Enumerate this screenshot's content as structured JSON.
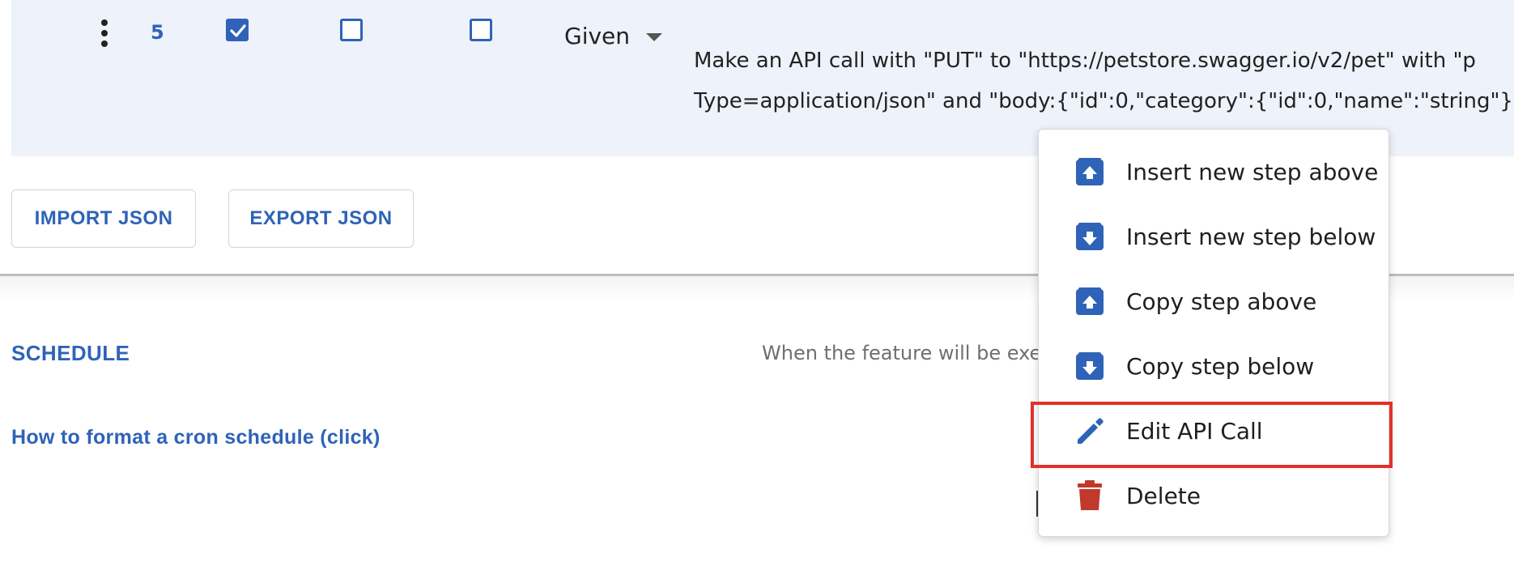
{
  "step": {
    "number": "5",
    "checkboxes": [
      true,
      false,
      false
    ],
    "keyword": "Given",
    "text_line1": "Make an API call with \"PUT\" to \"https://petstore.swagger.io/v2/pet\" with \"p",
    "text_line2": "Type=application/json\" and \"body:{\"id\":0,\"category\":{\"id\":0,\"name\":\"string\"},"
  },
  "buttons": {
    "import_label": "IMPORT JSON",
    "export_label": "EXPORT JSON"
  },
  "schedule": {
    "title": "SCHEDULE",
    "description": "When the feature will be execu",
    "cron_link": "How to format a cron schedule (click)"
  },
  "context_menu": {
    "items": [
      {
        "label": "Insert new step above",
        "icon": "insert-above-icon"
      },
      {
        "label": "Insert new step below",
        "icon": "insert-below-icon"
      },
      {
        "label": "Copy step above",
        "icon": "copy-above-icon"
      },
      {
        "label": "Copy step below",
        "icon": "copy-below-icon"
      },
      {
        "label": "Edit API Call",
        "icon": "pencil-icon"
      },
      {
        "label": "Delete",
        "icon": "trash-icon"
      }
    ],
    "highlighted_item": "Edit API Call"
  },
  "colors": {
    "accent": "#2f63b8",
    "row_background": "#eef2fa",
    "highlight": "#e0312a",
    "delete": "#c0392b"
  }
}
